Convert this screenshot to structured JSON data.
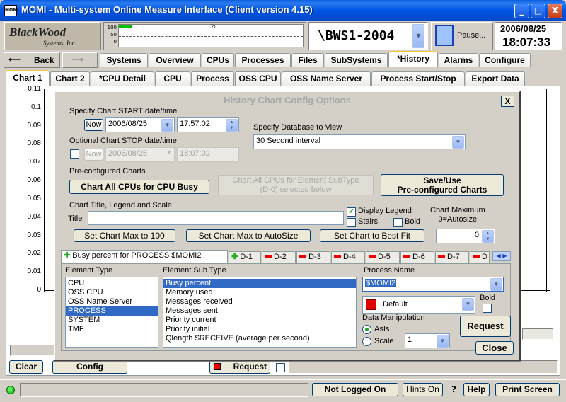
{
  "window": {
    "title": "MOMI - Multi-system Online Measure Interface (Client version 4.15)",
    "icon_text": "MOMI",
    "min": "_",
    "max": "□",
    "close": "X"
  },
  "logo": {
    "line1": "BlackWood",
    "line2": "Systems, Inc."
  },
  "meter": {
    "labels": [
      "100",
      "50",
      "0"
    ],
    "pct": "%"
  },
  "system": {
    "name": "\\BWS1-2004",
    "pause": "Pause...",
    "date": "2006/08/25",
    "time": "18:07:33"
  },
  "nav": {
    "back": "Back",
    "forward": ""
  },
  "main_tabs": [
    "Systems",
    "Overview",
    "CPUs",
    "Processes",
    "Files",
    "SubSystems",
    "*History",
    "Alarms",
    "Configure"
  ],
  "sub_tabs": [
    "Chart 1",
    "Chart 2",
    "*CPU Detail",
    "CPU",
    "Process",
    "OSS CPU",
    "OSS Name Server",
    "Process Start/Stop",
    "Export Data"
  ],
  "chart_data": {
    "type": "line",
    "yticks": [
      "0.11",
      "0.1",
      "0.09",
      "0.08",
      "0.07",
      "0.06",
      "0.05",
      "0.04",
      "0.03",
      "0.02",
      "0.01",
      "0"
    ],
    "series": []
  },
  "dialog": {
    "title": "History Chart Config Options",
    "close": "X",
    "start": {
      "label": "Specify Chart START date/time",
      "now": "Now",
      "date": "2006/08/25",
      "time": "17:57:02"
    },
    "stop": {
      "label": "Optional Chart STOP date/time",
      "now": "Now",
      "date": "2006/08/25",
      "time": "18:07:02"
    },
    "database": {
      "label": "Specify Database to View",
      "value": "30 Second interval"
    },
    "preconf": {
      "label": "Pre-configured Charts",
      "chart_all": "Chart All CPUs for CPU Busy",
      "subtype_line1": "Chart All CPUs for Element SubType",
      "subtype_line2": "(D-0) selected below",
      "save_line1": "Save/Use",
      "save_line2": "Pre-configured Charts"
    },
    "title_group": {
      "label": "Chart Title, Legend and Scale",
      "title_label": "Title",
      "title_value": "",
      "display_legend": "Display Legend",
      "stairs": "Stairs",
      "bold": "Bold",
      "chart_max_line1": "Chart Maximum",
      "chart_max_line2": "0=Autosize",
      "max_value": "0",
      "set_100": "Set Chart Max to 100",
      "set_auto": "Set Chart Max to AutoSize",
      "best_fit": "Set Chart to Best Fit"
    },
    "d_tabs": [
      "Busy percent for PROCESS $MOMI2",
      "D-1",
      "D-2",
      "D-3",
      "D-4",
      "D-5",
      "D-6",
      "D-7",
      "D"
    ],
    "element_type": {
      "label": "Element Type",
      "items": [
        "CPU",
        "OSS CPU",
        "OSS Name Server",
        "PROCESS",
        "SYSTEM",
        "TMF"
      ],
      "selected": 3
    },
    "element_sub_type": {
      "label": "Element Sub Type",
      "items": [
        "Busy percent",
        "Memory used",
        "Messages received",
        "Messages sent",
        "Priority current",
        "Priority initial",
        "Qlength $RECEIVE (average per second)"
      ],
      "selected": 0
    },
    "process_name": {
      "label": "Process Name",
      "value": "$MOMI2"
    },
    "color": {
      "value": "Default",
      "swatch": "#e00000"
    },
    "bold": "Bold",
    "data_manip": {
      "label": "Data Manipulation",
      "asis": "AsIs",
      "scale": "Scale",
      "scale_value": "1"
    },
    "request": "Request",
    "close_btn": "Close"
  },
  "bottom": {
    "clear": "Clear",
    "config": "Config",
    "request": "Request"
  },
  "status": {
    "not_logged": "Not Logged On",
    "hints": "Hints On",
    "q": "?",
    "help": "Help",
    "print": "Print Screen"
  }
}
